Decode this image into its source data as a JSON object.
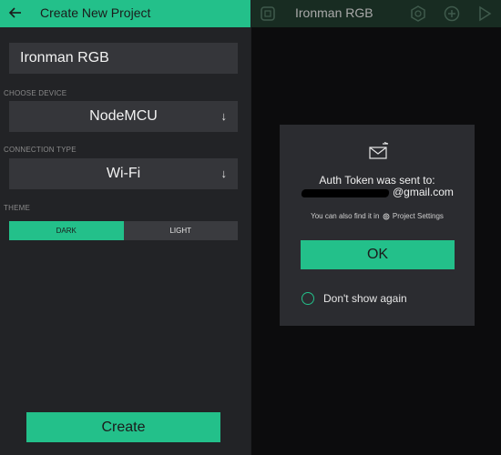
{
  "left_screen": {
    "title": "Create New Project",
    "project_name": "Ironman RGB",
    "choose_device_label": "CHOOSE DEVICE",
    "device_value": "NodeMCU",
    "connection_type_label": "CONNECTION TYPE",
    "connection_value": "Wi-Fi",
    "theme_label": "THEME",
    "theme_dark_label": "DARK",
    "theme_light_label": "LIGHT",
    "selected_theme": "DARK",
    "create_label": "Create"
  },
  "right_screen": {
    "title": "Ironman RGB",
    "dialog": {
      "sent_label": "Auth Token was sent to:",
      "email_visible_part": "@gmail.com",
      "find_prefix": "You can also find it in",
      "find_suffix": "Project Settings",
      "ok_label": "OK",
      "dont_show_label": "Don't show again"
    }
  },
  "colors": {
    "accent": "#23c08a",
    "panel_bg": "#222326",
    "field_bg": "#35363a",
    "dialog_bg": "#2b2c30",
    "right_topbar_bg": "#182c22"
  },
  "icons": [
    "back-arrow-icon",
    "chevron-down-icon",
    "device-box-icon",
    "hexagon-settings-icon",
    "plus-circle-icon",
    "play-triangle-icon",
    "mail-icon",
    "gear-icon"
  ]
}
